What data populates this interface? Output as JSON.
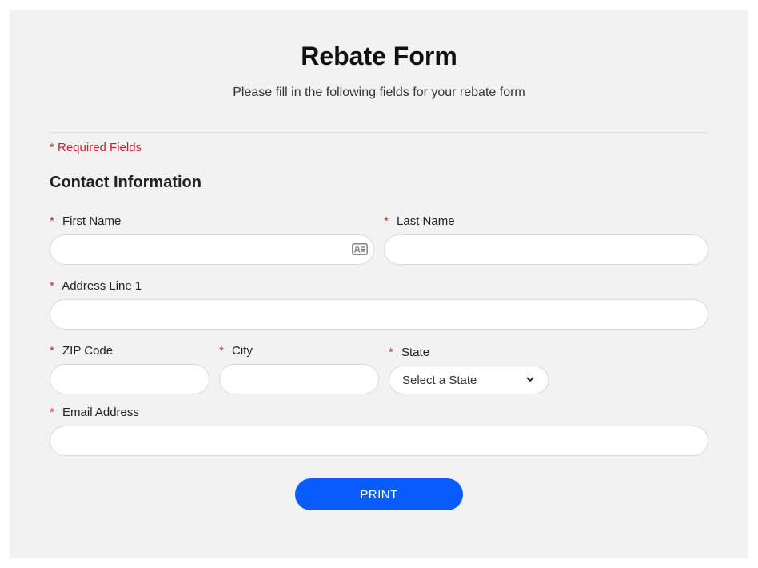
{
  "title": "Rebate Form",
  "subtitle": "Please fill in the following fields for your rebate form",
  "required_note": "* Required Fields",
  "section_title": "Contact Information",
  "asterisk": "*",
  "fields": {
    "first_name": {
      "label": "First Name",
      "value": ""
    },
    "last_name": {
      "label": "Last Name",
      "value": ""
    },
    "address1": {
      "label": "Address Line 1",
      "value": ""
    },
    "zip": {
      "label": "ZIP Code",
      "value": ""
    },
    "city": {
      "label": "City",
      "value": ""
    },
    "state": {
      "label": "State",
      "selected": "Select a State"
    },
    "email": {
      "label": "Email Address",
      "value": ""
    }
  },
  "buttons": {
    "print": "PRINT"
  }
}
